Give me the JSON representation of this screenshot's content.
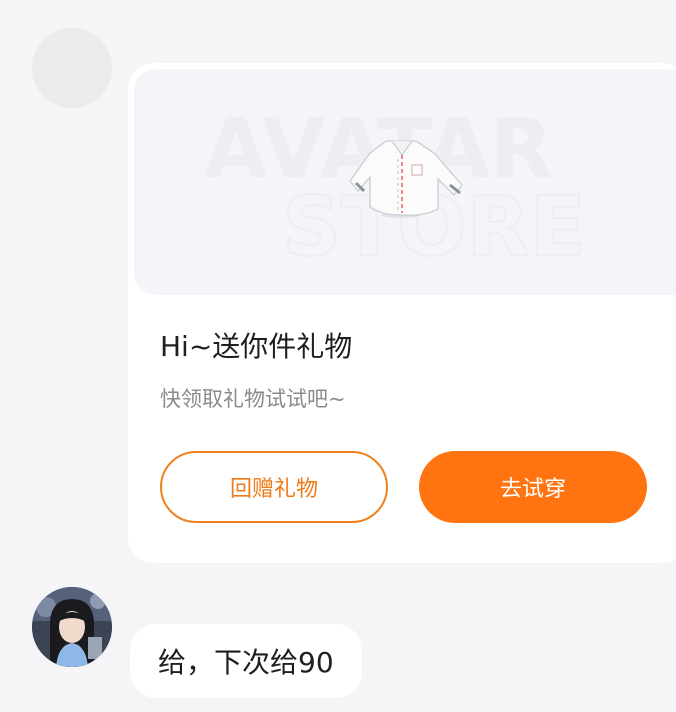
{
  "gift_card": {
    "banner_title_line1": "AVATAR",
    "banner_title_line2": "STORE",
    "title": "Hi~送你件礼物",
    "subtitle": "快领取礼物试试吧~",
    "return_gift_label": "回赠礼物",
    "try_on_label": "去试穿"
  },
  "message": {
    "text": "给，下次给90"
  },
  "colors": {
    "accent_orange": "#ff7410",
    "page_background": "#f5f5f7",
    "card_background": "#ffffff"
  }
}
